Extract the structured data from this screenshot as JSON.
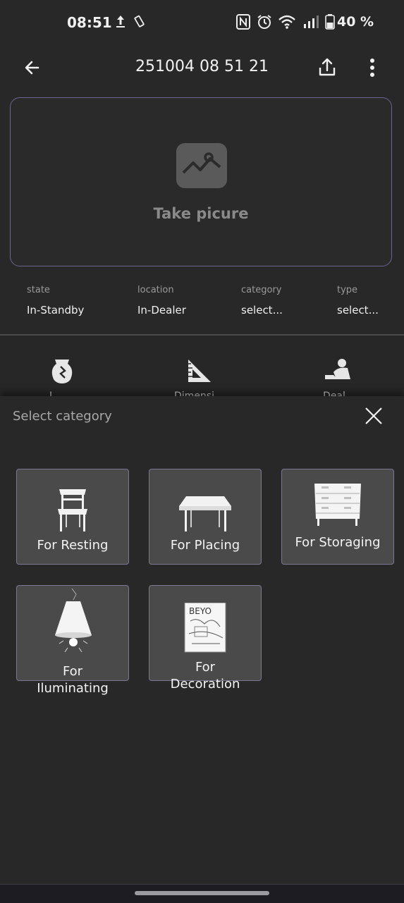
{
  "status_bar": {
    "time": "08:51",
    "battery_percent": "40 %",
    "icons": [
      "upload-icon",
      "vibrate-icon",
      "nfc-icon",
      "alarm-icon",
      "wifi-icon",
      "signal-icon",
      "battery-icon"
    ]
  },
  "app_bar": {
    "title": "251004 08 51 21",
    "icons": [
      "back-arrow-icon",
      "share-icon",
      "more-vert-icon"
    ]
  },
  "picture": {
    "label": "Take picure",
    "icon": "image-icon"
  },
  "info": {
    "state_label": "state",
    "state_value": "In-Standby",
    "location_label": "location",
    "location_value": "In-Dealer",
    "category_label": "category",
    "category_value": "select...",
    "type_label": "type",
    "type_value": "select..."
  },
  "tools": {
    "icons": [
      "broken-vase-icon",
      "ruler-triangle-icon",
      "dealer-icon"
    ],
    "labels": [
      "L",
      "Dimensi",
      "Deal"
    ]
  },
  "sheet": {
    "title": "Select category",
    "categories": [
      {
        "label": "For Resting",
        "icon": "chair-icon"
      },
      {
        "label": "For Placing",
        "icon": "table-icon"
      },
      {
        "label": "For Storaging",
        "icon": "dresser-icon"
      },
      {
        "label_line1": "For",
        "label_line2": "Iluminating",
        "icon": "lamp-icon"
      },
      {
        "label_line1": "For",
        "label_line2": "Decoration",
        "icon": "poster-icon",
        "poster_text": "BEYO"
      }
    ]
  },
  "colors": {
    "background": "#282828",
    "card_border": "#6b668e",
    "tile_background": "#4a4a4a"
  }
}
